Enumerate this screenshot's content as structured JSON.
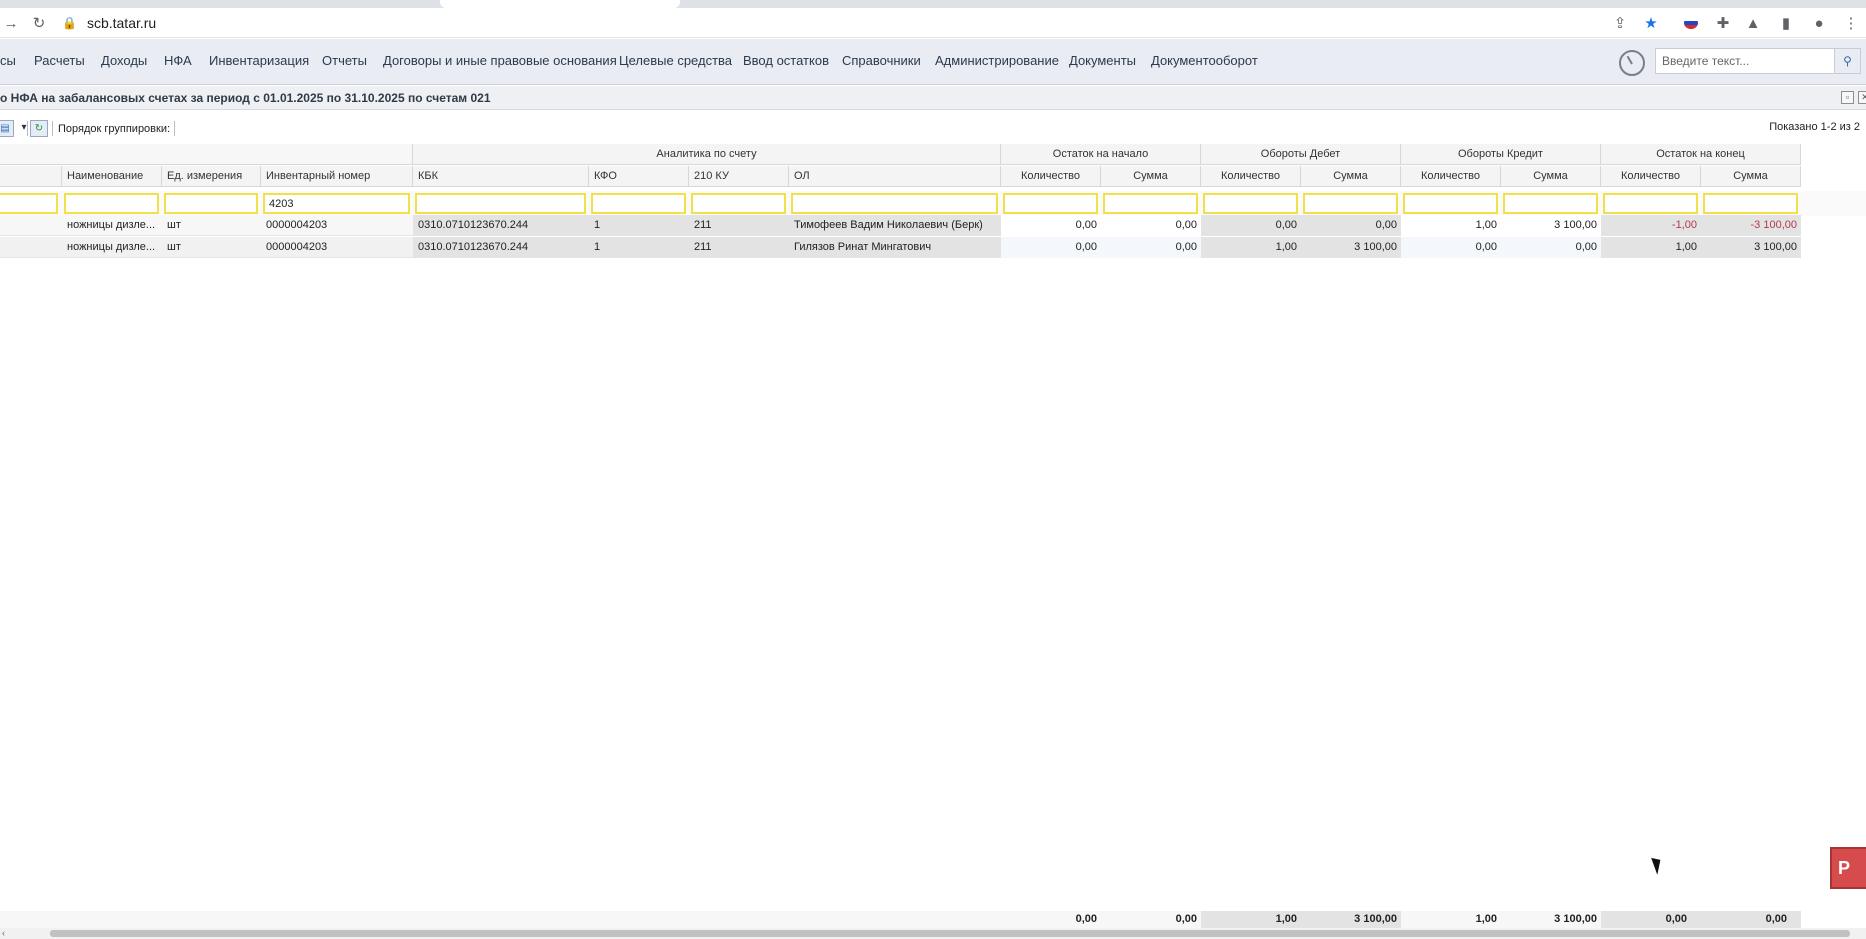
{
  "browser": {
    "url": "scb.tatar.ru",
    "back_icon": "arrow-back-icon",
    "reload_icon": "reload-icon"
  },
  "menu": {
    "items": [
      "сы",
      "Расчеты",
      "Доходы",
      "НФА",
      "Инвентаризация",
      "Отчеты",
      "Договоры и иные правовые основания",
      "Целевые средства",
      "Ввод остатков",
      "Справочники",
      "Администрирование",
      "Документы",
      "Документооборот"
    ],
    "search_placeholder": "Введите текст..."
  },
  "report": {
    "title": "о НФА на забалансовых счетах за период с 01.01.2025 по 31.10.2025 по счетам 021"
  },
  "grid_toolbar": {
    "grouping_label": "Порядок группировки:",
    "shown_label": "Показано 1-2 из 2"
  },
  "grid": {
    "group_headers": {
      "analytics": "Аналитика по счету",
      "opening": "Остаток на начало",
      "debit": "Обороты Дебет",
      "credit": "Обороты Кредит",
      "closing": "Остаток на конец"
    },
    "columns": [
      "Наименование",
      "Ед. измерения",
      "Инвентарный номер",
      "КБК",
      "КФО",
      "210 КУ",
      "ОЛ",
      "Количество",
      "Сумма",
      "Количество",
      "Сумма",
      "Количество",
      "Сумма",
      "Количество",
      "Сумма"
    ],
    "filter_inventory": "4203",
    "rows": [
      [
        "ножницы дизле...",
        "шт",
        "0000004203",
        "0310.0710123670.244",
        "1",
        "211",
        "Тимофеев Вадим Николаевич (Берк)",
        "0,00",
        "0,00",
        "0,00",
        "0,00",
        "1,00",
        "3 100,00",
        "-1,00",
        "-3 100,00"
      ],
      [
        "ножницы дизле...",
        "шт",
        "0000004203",
        "0310.0710123670.244",
        "1",
        "211",
        "Гилязов Ринат Мингатович",
        "0,00",
        "0,00",
        "1,00",
        "3 100,00",
        "0,00",
        "0,00",
        "1,00",
        "3 100,00"
      ]
    ],
    "totals": [
      "0,00",
      "0,00",
      "1,00",
      "3 100,00",
      "1,00",
      "3 100,00",
      "0,00",
      "0,00"
    ]
  },
  "colors": {
    "filter_border": "#f2e04a",
    "negative": "#b23a4a",
    "menu_bg": "#e9edf3"
  }
}
